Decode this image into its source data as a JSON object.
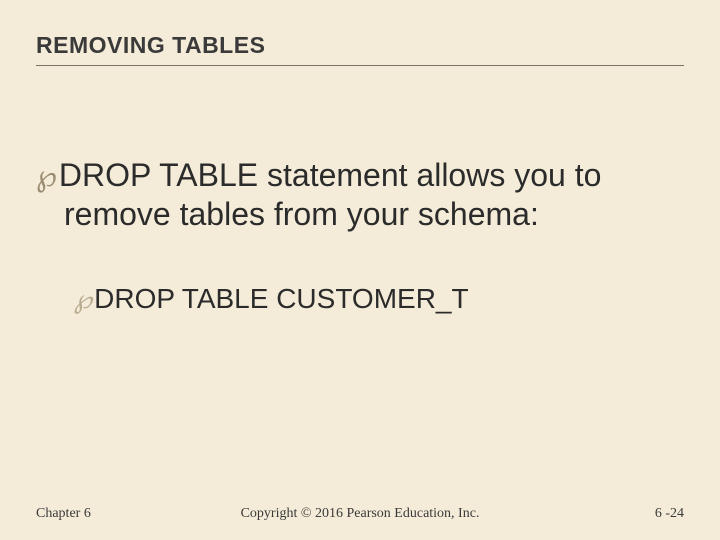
{
  "title": "REMOVING TABLES",
  "bullets": {
    "level1": {
      "marker": "℘",
      "text": "DROP TABLE statement allows you to remove tables from your schema:"
    },
    "level2": {
      "marker": "℘",
      "text": "DROP TABLE CUSTOMER_T"
    }
  },
  "footer": {
    "left": "Chapter 6",
    "center": "Copyright © 2016 Pearson Education, Inc.",
    "right": "6 -24"
  }
}
